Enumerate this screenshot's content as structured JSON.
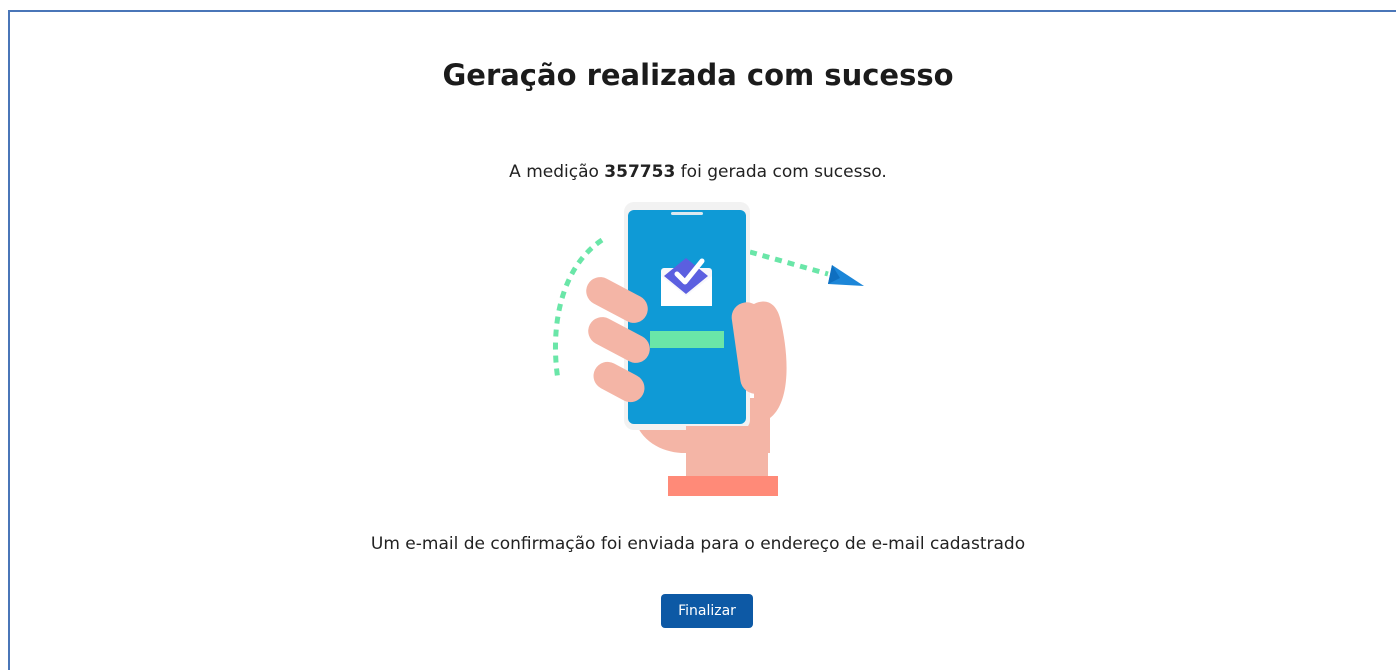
{
  "page": {
    "title": "Geração realizada com sucesso",
    "message": {
      "prefix": "A medição ",
      "number": "357753",
      "suffix": " foi gerada com sucesso."
    },
    "illustration_icon": "phone-mail-confirmation-illustration",
    "confirmation_text": "Um e-mail de confirmação foi enviada para o endereço de e-mail cadastrado",
    "finish_label": "Finalizar"
  },
  "colors": {
    "frame_border": "#4a76b8",
    "button": "#0d59a5",
    "phone_screen": "#0f9ad6",
    "accent_green": "#6ae6a8",
    "hand": "#f4b5a6",
    "sleeve": "#ff8a78",
    "arrow": "#1c86d8"
  }
}
